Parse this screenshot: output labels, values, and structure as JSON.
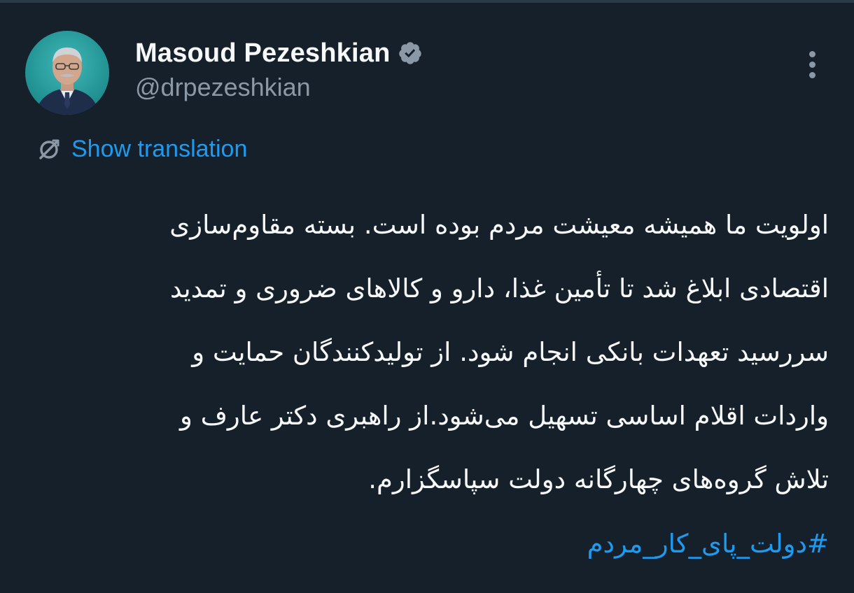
{
  "author": {
    "display_name": "Masoud Pezeshkian",
    "handle": "@drpezeshkian",
    "verified": true,
    "verified_color": "#8b98a5"
  },
  "actions": {
    "more_icon": "more-vertical-icon"
  },
  "translation": {
    "label": "Show translation",
    "icon": "translate-icon",
    "color": "#1d9bf0"
  },
  "tweet": {
    "lines": [
      "اولویت ما همیشه معیشت مردم بوده است. بسته مقاوم‌سازی",
      "اقتصادی ابلاغ شد تا تأمین غذا، دارو و کالاهای ضروری و تمدید",
      "سررسید تعهدات بانکی انجام شود. از تولیدکنندگان حمایت و",
      "واردات اقلام اساسی تسهیل می‌شود.از راهبری دکتر عارف و",
      "تلاش گروه‌های چهارگانه دولت سپاسگزارم."
    ],
    "hashtag": "#دولت_پای_کار_مردم"
  },
  "colors": {
    "background": "#15202b",
    "text": "#f7f9f9",
    "secondary": "#8b98a5",
    "accent": "#1d9bf0"
  }
}
